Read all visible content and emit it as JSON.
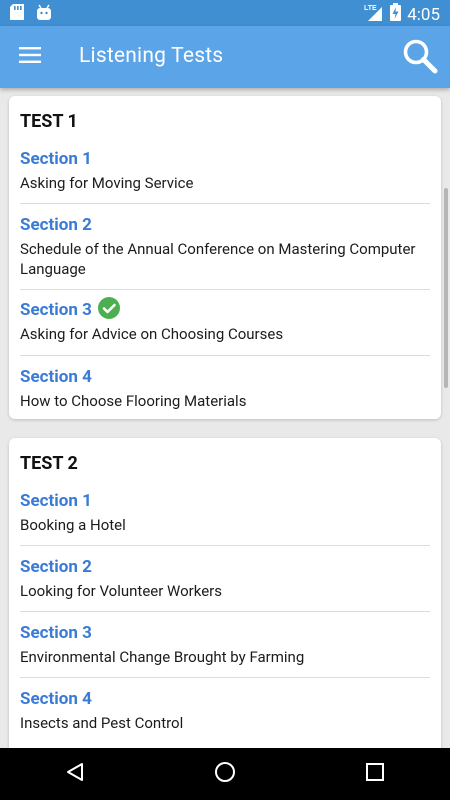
{
  "status_bar": {
    "time": "4:05",
    "network": "LTE",
    "battery": "charging"
  },
  "app_bar": {
    "title": "Listening Tests",
    "menu_icon": "hamburger-menu-icon",
    "search_icon": "search-icon"
  },
  "tests": [
    {
      "title": "TEST 1",
      "sections": [
        {
          "label": "Section 1",
          "description": "Asking for Moving Service",
          "completed": false
        },
        {
          "label": "Section 2",
          "description": "Schedule of the Annual Conference on Mastering Computer Language",
          "completed": false
        },
        {
          "label": "Section 3",
          "description": "Asking for Advice on Choosing Courses",
          "completed": true
        },
        {
          "label": "Section 4",
          "description": "How to Choose Flooring Materials",
          "completed": false
        }
      ]
    },
    {
      "title": "TEST 2",
      "sections": [
        {
          "label": "Section 1",
          "description": "Booking a Hotel",
          "completed": false
        },
        {
          "label": "Section 2",
          "description": "Looking for Volunteer Workers",
          "completed": false
        },
        {
          "label": "Section 3",
          "description": "Environmental Change Brought by Farming",
          "completed": false
        },
        {
          "label": "Section 4",
          "description": "Insects and Pest Control",
          "completed": false
        }
      ]
    }
  ],
  "colors": {
    "app_bar": "#5ba4e8",
    "status_bar": "#3f8fd2",
    "section_link": "#3a7bd5",
    "check": "#4caf50"
  }
}
